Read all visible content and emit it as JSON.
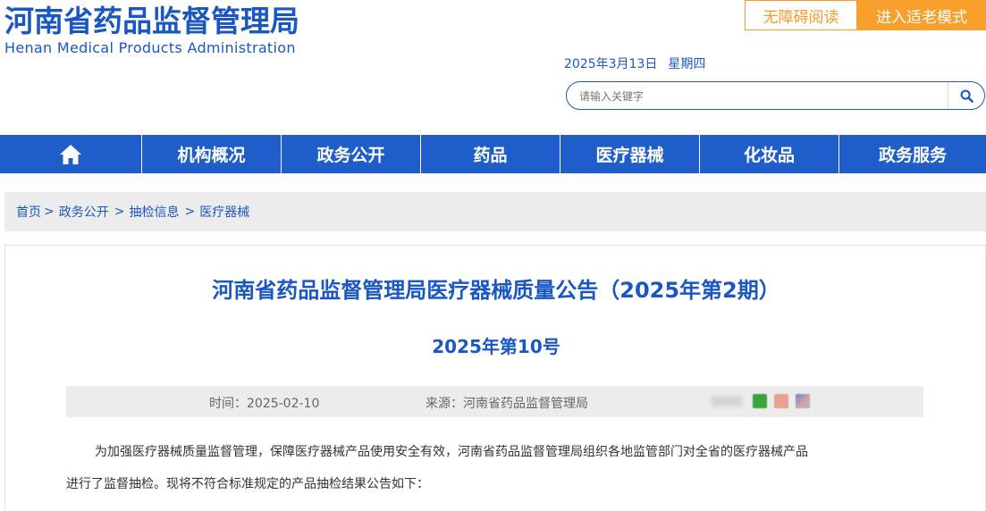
{
  "header": {
    "logo_cn": "河南省药品监督管理局",
    "logo_en": "Henan Medical Products Administration",
    "accessible_label": "无障碍阅读",
    "elder_mode_label": "进入适老模式",
    "date": "2025年3月13日",
    "weekday": "星期四",
    "search_placeholder": "请输入关键字",
    "brand_color": "#1a57c2",
    "accent_color": "#f7a02b"
  },
  "nav": {
    "home_icon": "home-icon",
    "items": [
      "机构概况",
      "政务公开",
      "药品",
      "医疗器械",
      "化妆品",
      "政务服务"
    ]
  },
  "breadcrumb": {
    "items": [
      "首页",
      "政务公开",
      "抽检信息",
      "医疗器械"
    ],
    "separators": [
      ">",
      ">",
      ">"
    ]
  },
  "article": {
    "title": "河南省药品监督管理局医疗器械质量公告（2025年第2期）",
    "number": "2025年第10号",
    "time": "时间：2025-02-10",
    "source": "来源：河南省药品监督管理局",
    "share_icons": [
      "wechat-icon",
      "weibo-icon",
      "qq-icon"
    ],
    "para1_line1": "为加强医疗器械质量监督管理，保障医疗器械产品使用安全有效，河南省药品监督管理局组织各地监管部门对全省的医疗器械产品",
    "para1_line2": "进行了监督抽检。现将不符合标准规定的产品抽检结果公告如下："
  }
}
